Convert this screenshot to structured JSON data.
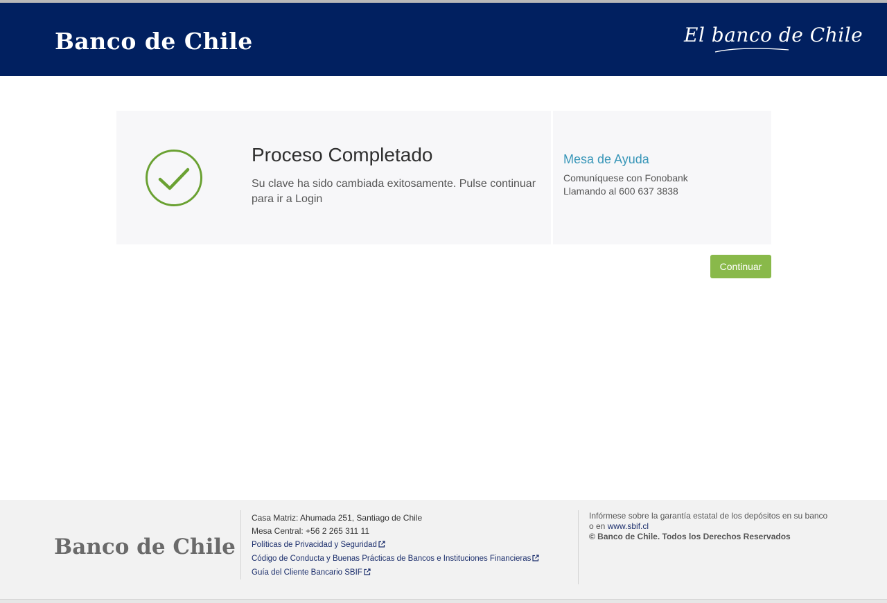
{
  "header": {
    "logo_text": "Banco de Chile",
    "tagline": "El banco de Chile",
    "background_color": "#012060"
  },
  "result": {
    "icon": "check-circle-icon",
    "title": "Proceso Completado",
    "message": "Su clave ha sido cambiada exitosamente. Pulse continuar para ir a Login",
    "success_color": "#6aa132"
  },
  "help": {
    "title": "Mesa de Ayuda",
    "line1": "Comuníquese con Fonobank",
    "line2": "Llamando al 600 637 3838",
    "title_color": "#3896b8"
  },
  "actions": {
    "continue_label": "Continuar",
    "button_color": "#89b94a"
  },
  "footer": {
    "logo_text": "Banco de Chile",
    "address": "Casa Matriz: Ahumada 251, Santiago de Chile",
    "phone": "Mesa Central: +56 2 265 311 11",
    "links": [
      "Políticas de Privacidad y Seguridad",
      "Código de Conducta y Buenas Prácticas de Bancos e Instituciones Financieras",
      "Guía del Cliente Bancario SBIF"
    ],
    "deposit_text": "Infórmese sobre la garantía estatal de los depósitos en su banco o en",
    "deposit_link": "www.sbif.cl",
    "copyright": "© Banco de Chile. Todos los Derechos Reservados"
  }
}
